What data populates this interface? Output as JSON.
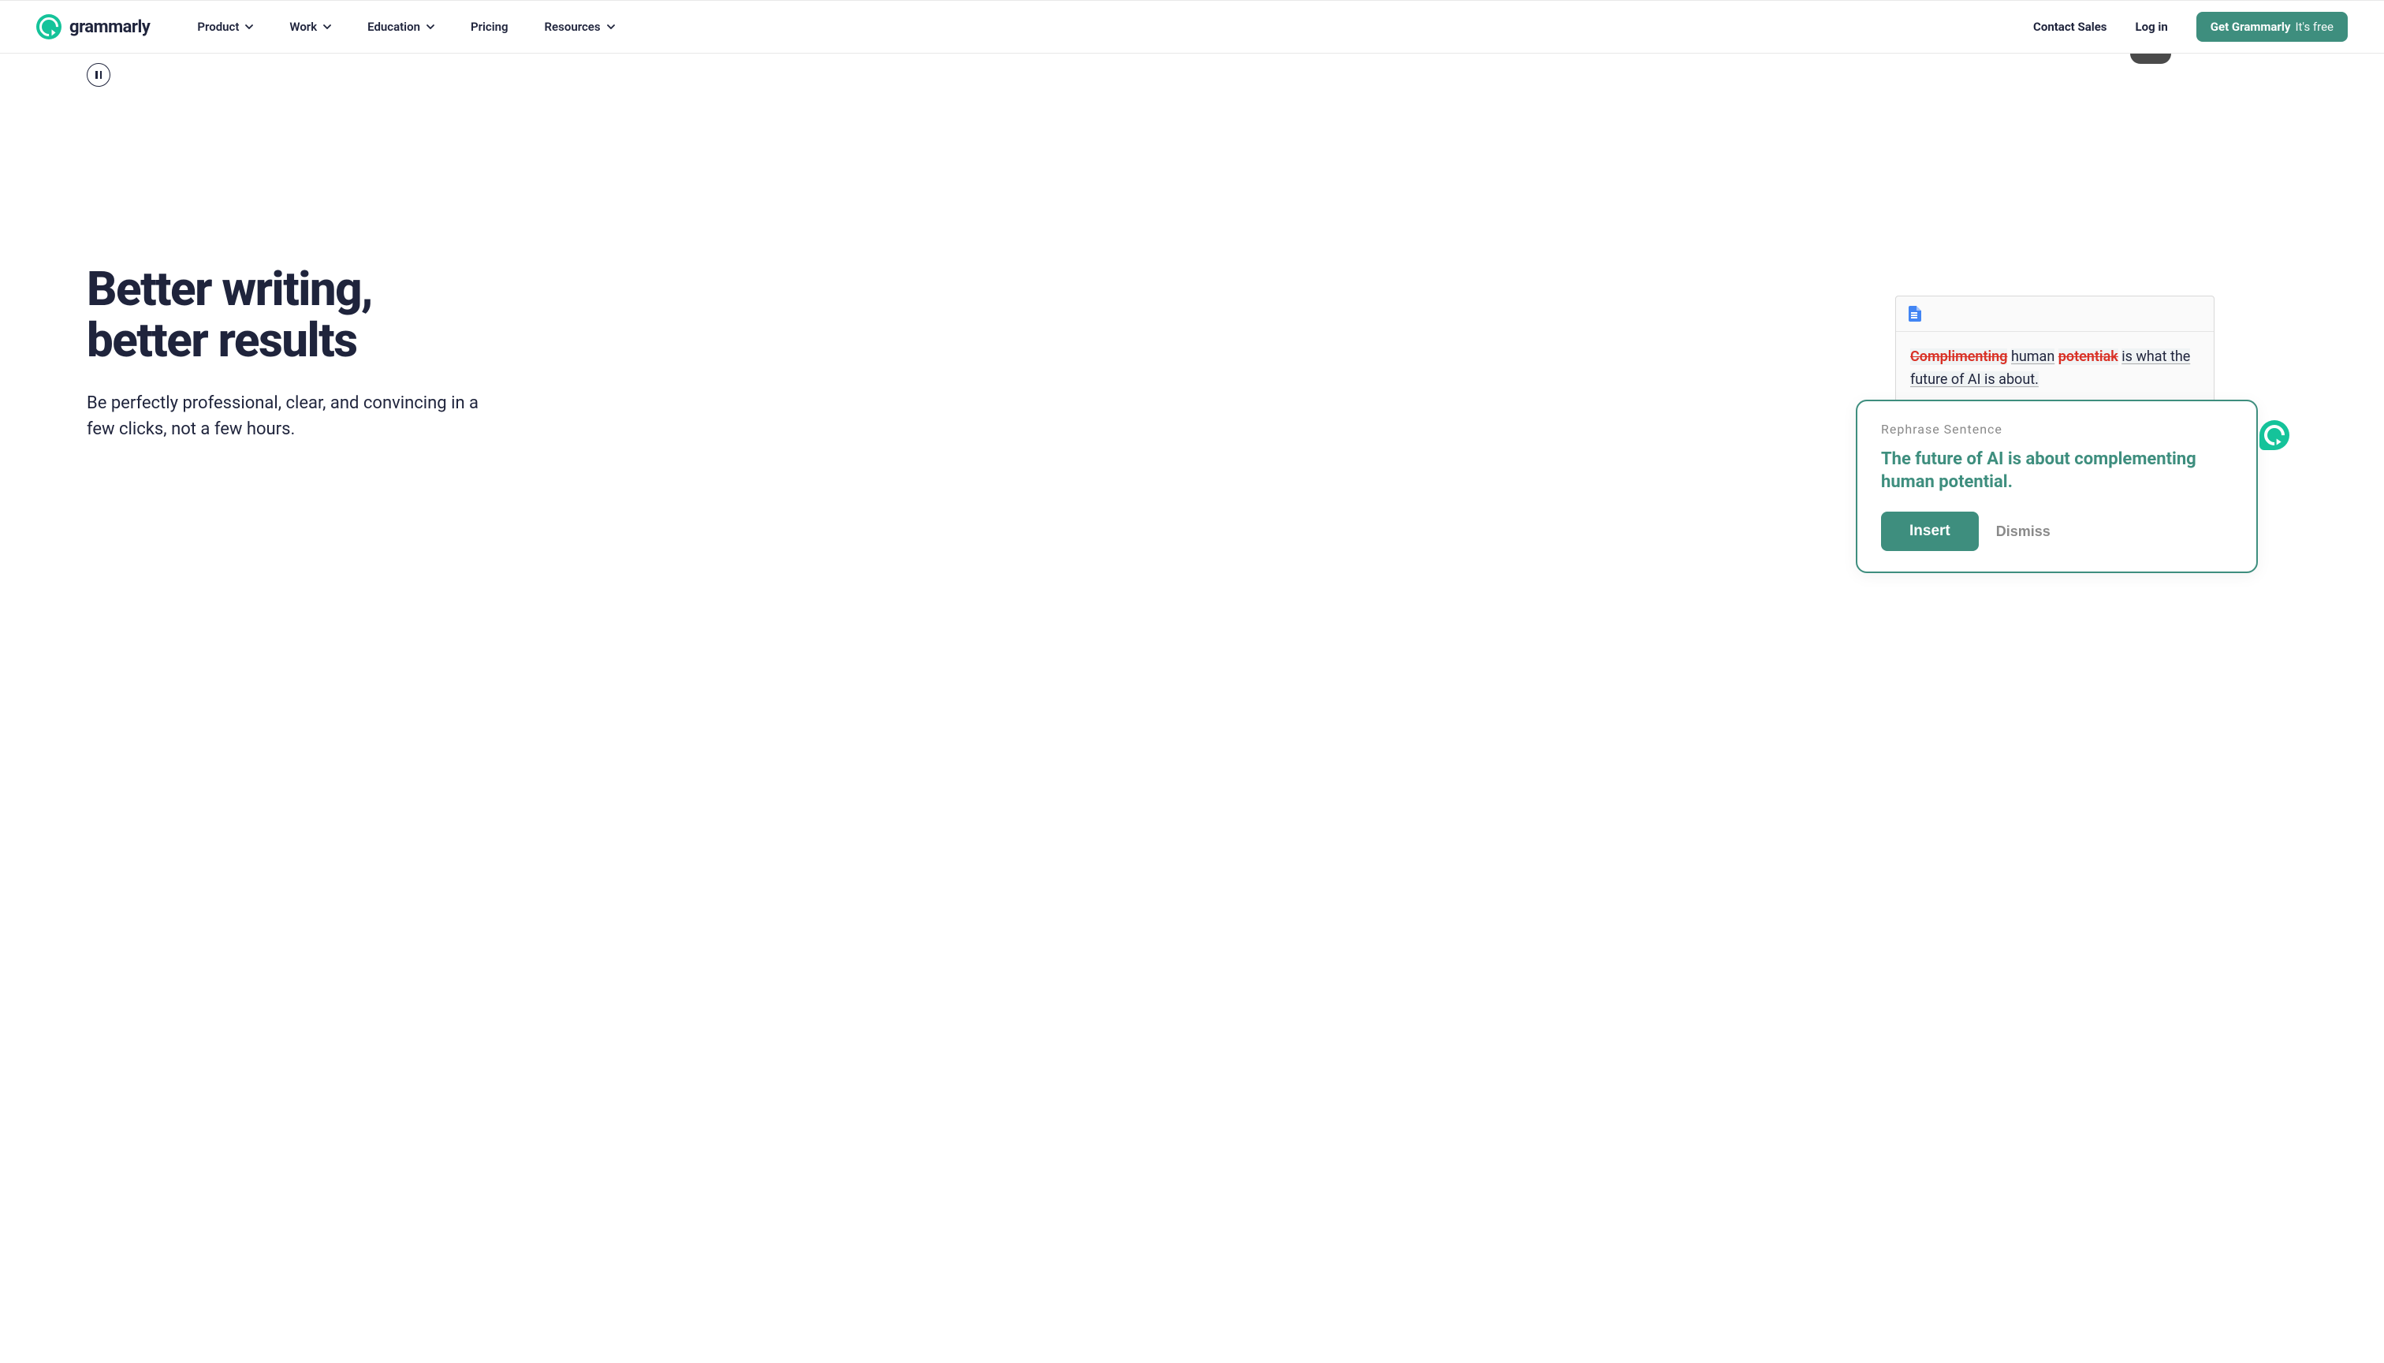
{
  "brand": {
    "name": "grammarly"
  },
  "nav": {
    "items": [
      {
        "label": "Product",
        "hasDropdown": true
      },
      {
        "label": "Work",
        "hasDropdown": true
      },
      {
        "label": "Education",
        "hasDropdown": true
      },
      {
        "label": "Pricing",
        "hasDropdown": false
      },
      {
        "label": "Resources",
        "hasDropdown": true
      }
    ]
  },
  "header_actions": {
    "contact": "Contact Sales",
    "login": "Log in",
    "cta_main": "Get Grammarly",
    "cta_sub": "It's free"
  },
  "hero": {
    "heading_line1": "Better writing,",
    "heading_line2": "better results",
    "subheading": "Be perfectly professional, clear, and convincing in a few clicks, not a few hours."
  },
  "demo": {
    "doc_text": {
      "strike1": "Complimenting",
      "word1": "human",
      "strike2": "potentiak",
      "rest": "is what the future of AI is about."
    },
    "suggestion": {
      "label": "Rephrase Sentence",
      "text": "The future of AI is about complementing human potential.",
      "insert": "Insert",
      "dismiss": "Dismiss"
    }
  }
}
